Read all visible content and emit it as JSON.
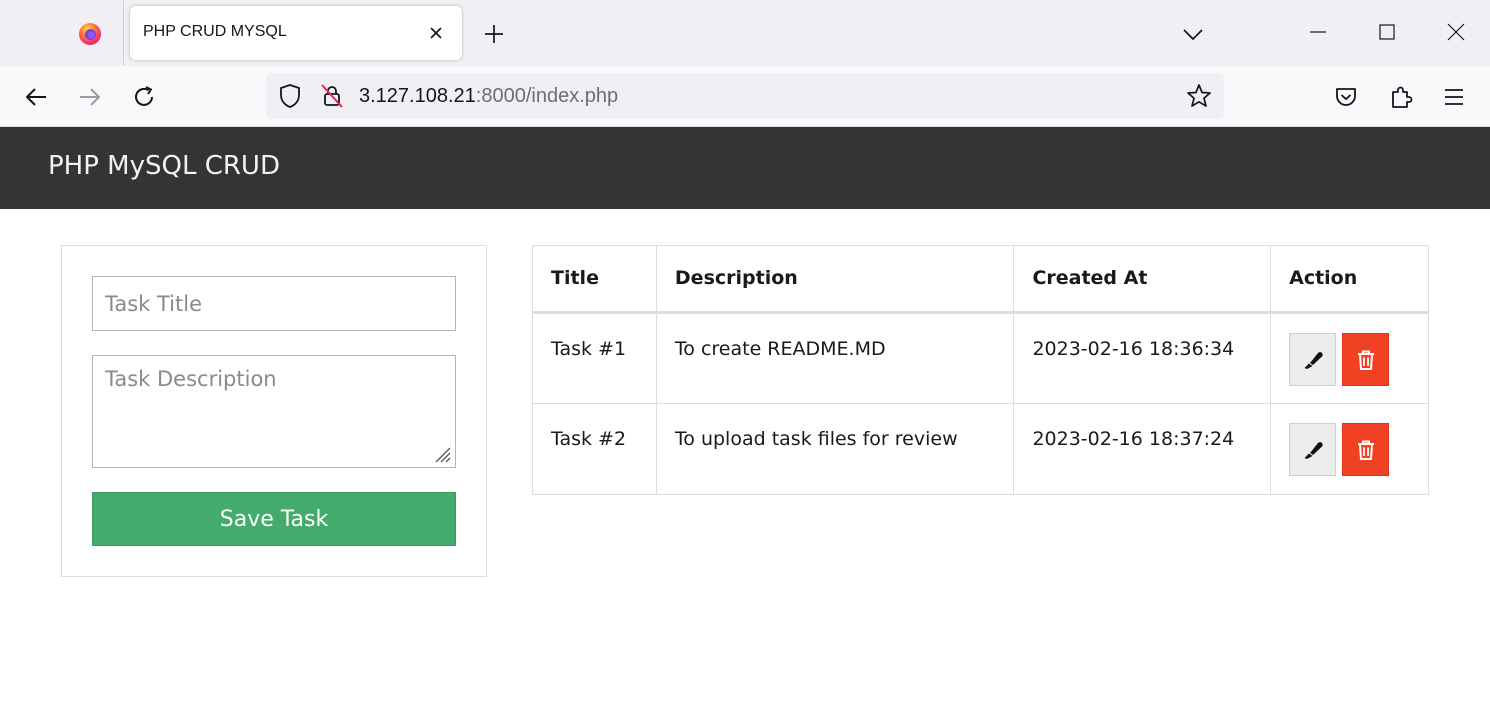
{
  "browser": {
    "tab_title": "PHP CRUD MYSQL",
    "url_host": "3.127.108.21",
    "url_rest": ":8000/index.php",
    "icons": [
      "firefox-icon",
      "close-icon",
      "plus-icon",
      "chevron-down-icon",
      "minimize-icon",
      "maximize-icon",
      "close-window-icon",
      "back-arrow-icon",
      "forward-arrow-icon",
      "reload-icon",
      "shield-icon",
      "insecure-lock-icon",
      "star-icon",
      "pocket-icon",
      "extensions-icon",
      "menu-icon"
    ]
  },
  "header": {
    "brand": "PHP MySQL CRUD",
    "background": "#343434"
  },
  "form": {
    "title_placeholder": "Task Title",
    "description_placeholder": "Task Description",
    "title_value": "",
    "description_value": "",
    "save_label": "Save Task",
    "save_color": "#43ab6b"
  },
  "table": {
    "columns": [
      "Title",
      "Description",
      "Created At",
      "Action"
    ],
    "rows": [
      {
        "title": "Task #1",
        "description": "To create README.MD",
        "created_at": "2023-02-16 18:36:34"
      },
      {
        "title": "Task #2",
        "description": "To upload task files for review",
        "created_at": "2023-02-16 18:37:24"
      }
    ],
    "edit_icon": "marker-icon",
    "delete_icon": "trash-icon",
    "delete_color": "#f04124"
  }
}
